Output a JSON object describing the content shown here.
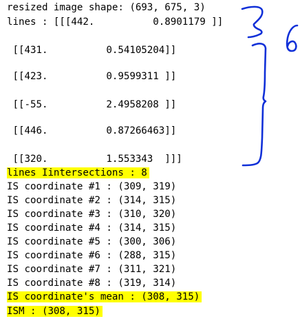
{
  "output": {
    "lines": [
      {
        "text": "resized image shape: (693, 675, 3)",
        "highlight": false
      },
      {
        "text": "lines : [[[442.          0.8901179 ]]",
        "highlight": false
      },
      {
        "text": "",
        "highlight": false
      },
      {
        "text": " [[431.          0.54105204]]",
        "highlight": false
      },
      {
        "text": "",
        "highlight": false
      },
      {
        "text": " [[423.          0.9599311 ]]",
        "highlight": false
      },
      {
        "text": "",
        "highlight": false
      },
      {
        "text": " [[-55.          2.4958208 ]]",
        "highlight": false
      },
      {
        "text": "",
        "highlight": false
      },
      {
        "text": " [[446.          0.87266463]]",
        "highlight": false
      },
      {
        "text": "",
        "highlight": false
      },
      {
        "text": " [[320.          1.553343  ]]]",
        "highlight": false
      },
      {
        "text": "lines Iintersections : 8",
        "highlight": true
      },
      {
        "text": "IS coordinate #1 : (309, 319)",
        "highlight": false
      },
      {
        "text": "IS coordinate #2 : (314, 315)",
        "highlight": false
      },
      {
        "text": "IS coordinate #3 : (310, 320)",
        "highlight": false
      },
      {
        "text": "IS coordinate #4 : (314, 315)",
        "highlight": false
      },
      {
        "text": "IS coordinate #5 : (300, 306)",
        "highlight": false
      },
      {
        "text": "IS coordinate #6 : (288, 315)",
        "highlight": false
      },
      {
        "text": "IS coordinate #7 : (311, 321)",
        "highlight": false
      },
      {
        "text": "IS coordinate #8 : (319, 314)",
        "highlight": false
      },
      {
        "text": "IS coordinate's mean : (308, 315)",
        "highlight": true
      },
      {
        "text": "ISM : (308, 315)",
        "highlight": true
      }
    ]
  },
  "annotation": {
    "handwritten_text": "6",
    "ink_color": "#1030d8",
    "highlight_color": "#ffff00"
  }
}
